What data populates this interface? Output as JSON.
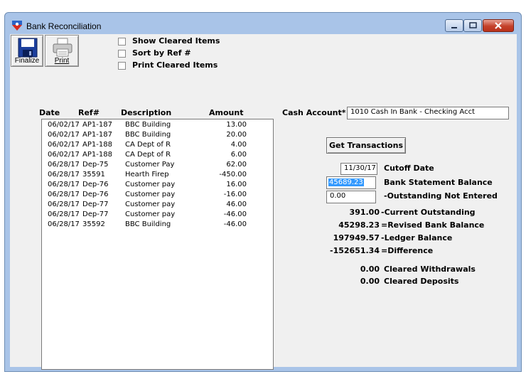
{
  "window": {
    "title": "Bank Reconciliation"
  },
  "toolbar": {
    "finalize_label": "Finalize",
    "print_label": "Print"
  },
  "options": [
    {
      "label": "Show Cleared Items",
      "checked": false
    },
    {
      "label": "Sort by Ref #",
      "checked": false
    },
    {
      "label": "Print Cleared Items",
      "checked": false
    }
  ],
  "table": {
    "headers": {
      "date": "Date",
      "ref": "Ref#",
      "description": "Description",
      "amount": "Amount"
    },
    "rows": [
      {
        "date": "06/02/17",
        "ref": "AP1-187",
        "description": "BBC Building",
        "amount": "13.00"
      },
      {
        "date": "06/02/17",
        "ref": "AP1-187",
        "description": "BBC Building",
        "amount": "20.00"
      },
      {
        "date": "06/02/17",
        "ref": "AP1-188",
        "description": "CA Dept of R",
        "amount": "4.00"
      },
      {
        "date": "06/02/17",
        "ref": "AP1-188",
        "description": "CA Dept of R",
        "amount": "6.00"
      },
      {
        "date": "06/28/17",
        "ref": "Dep-75",
        "description": "Customer Pay",
        "amount": "62.00"
      },
      {
        "date": "06/28/17",
        "ref": "35591",
        "description": "Hearth Firep",
        "amount": "-450.00"
      },
      {
        "date": "06/28/17",
        "ref": "Dep-76",
        "description": "Customer pay",
        "amount": "16.00"
      },
      {
        "date": "06/28/17",
        "ref": "Dep-76",
        "description": "Customer pay",
        "amount": "-16.00"
      },
      {
        "date": "06/28/17",
        "ref": "Dep-77",
        "description": "Customer pay",
        "amount": "46.00"
      },
      {
        "date": "06/28/17",
        "ref": "Dep-77",
        "description": "Customer pay",
        "amount": "-46.00"
      },
      {
        "date": "06/28/17",
        "ref": "35592",
        "description": "BBC Building",
        "amount": "-46.00"
      }
    ]
  },
  "cash_account": {
    "label": "Cash Account*",
    "value": "1010    Cash In Bank - Checking Acct"
  },
  "get_transactions_label": "Get Transactions",
  "cutoff": {
    "value": "11/30/17",
    "label": "Cutoff Date"
  },
  "bank_statement": {
    "value": "45689.23",
    "label": "Bank Statement Balance"
  },
  "outstanding_not_entered": {
    "value": "0.00",
    "label": "-Outstanding Not Entered"
  },
  "summary": [
    {
      "value": "391.00",
      "label": "-Current Outstanding"
    },
    {
      "value": "45298.23",
      "label": "=Revised Bank Balance"
    },
    {
      "value": "197949.57",
      "label": "-Ledger Balance"
    },
    {
      "value": "-152651.34",
      "label": "=Difference"
    }
  ],
  "cleared": [
    {
      "value": "0.00",
      "label": "Cleared Withdrawals"
    },
    {
      "value": "0.00",
      "label": "Cleared Deposits"
    }
  ]
}
